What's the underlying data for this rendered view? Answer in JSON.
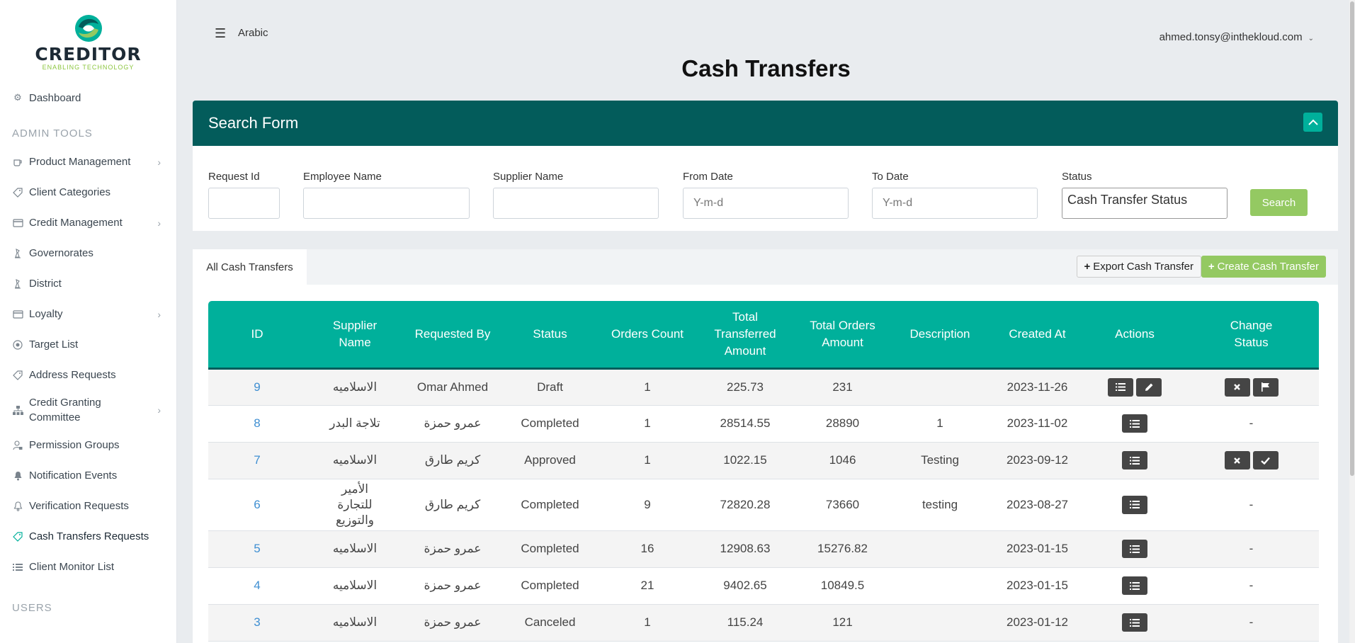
{
  "brand": {
    "name": "CREDITOR",
    "tagline": "ENABLING TECHNOLOGY",
    "colors": {
      "primary_dark": "#035c5b",
      "primary": "#00b09b",
      "accent_green": "#94c962"
    }
  },
  "sidebar": {
    "dashboard": "Dashboard",
    "admin_section": "ADMIN TOOLS",
    "items": [
      {
        "label": "Product Management",
        "icon": "cup-icon",
        "has_submenu": true
      },
      {
        "label": "Client Categories",
        "icon": "tag-icon",
        "has_submenu": false
      },
      {
        "label": "Credit Management",
        "icon": "credit-card-icon",
        "has_submenu": true
      },
      {
        "label": "Governorates",
        "icon": "chess-icon",
        "has_submenu": false
      },
      {
        "label": "District",
        "icon": "chess-icon",
        "has_submenu": false
      },
      {
        "label": "Loyalty",
        "icon": "credit-card-icon",
        "has_submenu": true
      },
      {
        "label": "Target List",
        "icon": "target-icon",
        "has_submenu": false
      },
      {
        "label": "Address Requests",
        "icon": "tag-icon",
        "has_submenu": false
      },
      {
        "label": "Credit Granting Committee",
        "icon": "sitemap-icon",
        "has_submenu": true
      },
      {
        "label": "Permission Groups",
        "icon": "user-lock-icon",
        "has_submenu": false
      },
      {
        "label": "Notification Events",
        "icon": "bell-solid-icon",
        "has_submenu": false
      },
      {
        "label": "Verification Requests",
        "icon": "bell-outline-icon",
        "has_submenu": false
      },
      {
        "label": "Cash Transfers Requests",
        "icon": "tag-icon",
        "has_submenu": false,
        "active": true
      },
      {
        "label": "Client Monitor List",
        "icon": "list-icon",
        "has_submenu": false
      }
    ],
    "users_section": "USERS"
  },
  "header": {
    "language": "Arabic",
    "user_email": "ahmed.tonsy@inthekloud.com"
  },
  "page_title": "Cash Transfers",
  "search_form": {
    "title": "Search Form",
    "fields": {
      "request_id": {
        "label": "Request Id",
        "value": "",
        "placeholder": ""
      },
      "employee_name": {
        "label": "Employee Name",
        "value": "",
        "placeholder": ""
      },
      "supplier_name": {
        "label": "Supplier Name",
        "value": "",
        "placeholder": ""
      },
      "from_date": {
        "label": "From Date",
        "value": "",
        "placeholder": "Y-m-d"
      },
      "to_date": {
        "label": "To Date",
        "value": "",
        "placeholder": "Y-m-d"
      },
      "status": {
        "label": "Status",
        "value": "Cash Transfer Status"
      }
    },
    "search_label": "Search"
  },
  "list": {
    "tab": "All Cash Transfers",
    "export_label": "Export Cash Transfer",
    "create_label": "Create Cash Transfer",
    "columns": [
      "ID",
      "Supplier Name",
      "Requested By",
      "Status",
      "Orders Count",
      "Total Transferred Amount",
      "Total Orders Amount",
      "Description",
      "Created At",
      "Actions",
      "Change Status"
    ],
    "rows": [
      {
        "id": "9",
        "supplier": "الاسلاميه",
        "requested_by": "Omar Ahmed",
        "status": "Draft",
        "orders_count": "1",
        "total_transferred": "225.73",
        "total_orders": "231",
        "description": "",
        "created_at": "2023-11-26",
        "actions": [
          "list",
          "edit"
        ],
        "change_status": [
          "reject",
          "flag"
        ]
      },
      {
        "id": "8",
        "supplier": "تلاجة البدر",
        "requested_by": "عمرو حمزة",
        "status": "Completed",
        "orders_count": "1",
        "total_transferred": "28514.55",
        "total_orders": "28890",
        "description": "1",
        "created_at": "2023-11-02",
        "actions": [
          "list"
        ],
        "change_status_text": "-"
      },
      {
        "id": "7",
        "supplier": "الاسلاميه",
        "requested_by": "كريم طارق",
        "status": "Approved",
        "orders_count": "1",
        "total_transferred": "1022.15",
        "total_orders": "1046",
        "description": "Testing",
        "created_at": "2023-09-12",
        "actions": [
          "list"
        ],
        "change_status": [
          "reject",
          "check"
        ]
      },
      {
        "id": "6",
        "supplier": "الأمير للتجارة والتوزيع",
        "requested_by": "كريم طارق",
        "status": "Completed",
        "orders_count": "9",
        "total_transferred": "72820.28",
        "total_orders": "73660",
        "description": "testing",
        "created_at": "2023-08-27",
        "actions": [
          "list"
        ],
        "change_status_text": "-"
      },
      {
        "id": "5",
        "supplier": "الاسلاميه",
        "requested_by": "عمرو حمزة",
        "status": "Completed",
        "orders_count": "16",
        "total_transferred": "12908.63",
        "total_orders": "15276.82",
        "description": "",
        "created_at": "2023-01-15",
        "actions": [
          "list"
        ],
        "change_status_text": "-"
      },
      {
        "id": "4",
        "supplier": "الاسلاميه",
        "requested_by": "عمرو حمزة",
        "status": "Completed",
        "orders_count": "21",
        "total_transferred": "9402.65",
        "total_orders": "10849.5",
        "description": "",
        "created_at": "2023-01-15",
        "actions": [
          "list"
        ],
        "change_status_text": "-"
      },
      {
        "id": "3",
        "supplier": "الاسلاميه",
        "requested_by": "عمرو حمزة",
        "status": "Canceled",
        "orders_count": "1",
        "total_transferred": "115.24",
        "total_orders": "121",
        "description": "",
        "created_at": "2023-01-12",
        "actions": [
          "list"
        ],
        "change_status_text": "-"
      }
    ]
  }
}
